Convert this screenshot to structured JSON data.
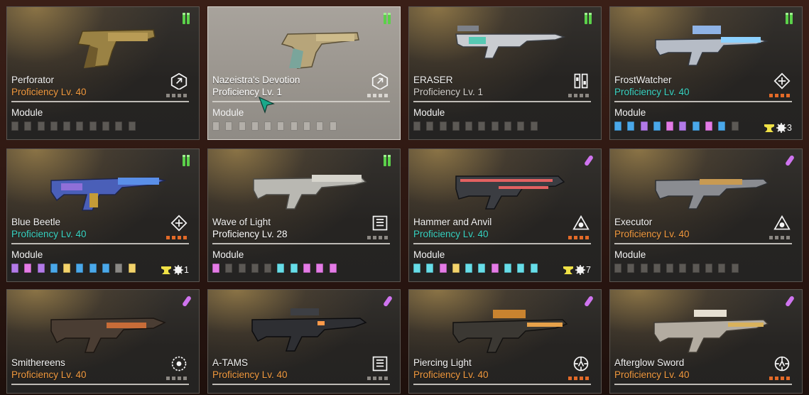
{
  "colors": {
    "orange": "#f29a3f",
    "teal": "#39d4c3",
    "gray": "#d2cfcb",
    "white": "#ffffff",
    "slot_empty": "#5c5955",
    "slot_blue": "#4aa8ea",
    "slot_pink": "#e47be6",
    "slot_purple": "#b27ae8",
    "slot_yellow": "#f3d36b",
    "slot_gray": "#8a8885",
    "slot_cyan": "#67dde8",
    "ammo_green": "#5bd14a",
    "ammo_purple": "#cf74ef"
  },
  "weapons": [
    {
      "name": "Perforator",
      "proficiency": "Proficiency Lv. 40",
      "prof_color": "orange",
      "ammo": "green",
      "ammo_icon": "general-rounds-icon",
      "type_icon": "type-hand-cannon-icon",
      "tier": 0,
      "module_label": "Module",
      "modules": [
        "empty",
        "empty",
        "empty",
        "empty",
        "empty",
        "empty",
        "empty",
        "empty",
        "empty",
        "empty"
      ],
      "capacity": null,
      "gun": "gold-revolver",
      "selected": false
    },
    {
      "name": "Nazeistra's Devotion",
      "proficiency": "Proficiency Lv. 1",
      "prof_color": "white",
      "ammo": "green",
      "ammo_icon": "general-rounds-icon",
      "type_icon": "type-hand-cannon-icon",
      "tier": 0,
      "module_label": "Module",
      "modules": [
        "empty",
        "empty",
        "empty",
        "empty",
        "empty",
        "empty",
        "empty",
        "empty",
        "empty",
        "empty"
      ],
      "capacity": null,
      "gun": "ornate-revolver",
      "selected": true
    },
    {
      "name": "ERASER",
      "proficiency": "Proficiency Lv. 1",
      "prof_color": "gray",
      "ammo": "green",
      "ammo_icon": "general-rounds-icon",
      "type_icon": "type-tactical-rifle-icon",
      "tier": 0,
      "module_label": "Module",
      "modules": [
        "empty",
        "empty",
        "empty",
        "empty",
        "empty",
        "empty",
        "empty",
        "empty",
        "empty",
        "empty"
      ],
      "capacity": null,
      "gun": "white-rifle",
      "selected": false
    },
    {
      "name": "FrostWatcher",
      "proficiency": "Proficiency Lv. 40",
      "prof_color": "teal",
      "ammo": "green",
      "ammo_icon": "general-rounds-icon",
      "type_icon": "type-assault-rifle-icon",
      "tier": 5,
      "module_label": "Module",
      "modules": [
        "blue",
        "blue",
        "purple",
        "blue",
        "pink",
        "purple",
        "blue",
        "pink",
        "blue",
        "empty"
      ],
      "capacity": "3",
      "gun": "frost-rifle",
      "selected": false
    },
    {
      "name": "Blue Beetle",
      "proficiency": "Proficiency Lv. 40",
      "prof_color": "teal",
      "ammo": "green",
      "ammo_icon": "general-rounds-icon",
      "type_icon": "type-assault-rifle-icon",
      "tier": 5,
      "module_label": "Module",
      "modules": [
        "purple",
        "pink",
        "purple",
        "blue",
        "yellow",
        "blue",
        "blue",
        "blue",
        "gray",
        "yellow"
      ],
      "capacity": "1",
      "gun": "beetle-rifle",
      "selected": false
    },
    {
      "name": "Wave of Light",
      "proficiency": "Proficiency Lv. 28",
      "prof_color": "white",
      "ammo": "green",
      "ammo_icon": "general-rounds-icon",
      "type_icon": "type-machine-gun-icon",
      "tier": 0,
      "module_label": "Module",
      "modules": [
        "pink",
        "empty",
        "empty",
        "empty",
        "empty",
        "cyan",
        "cyan",
        "pink",
        "pink",
        "pink"
      ],
      "capacity": null,
      "gun": "light-rifle",
      "selected": false
    },
    {
      "name": "Hammer and Anvil",
      "proficiency": "Proficiency Lv. 40",
      "prof_color": "teal",
      "ammo": "purple",
      "ammo_icon": "impact-rounds-icon",
      "type_icon": "type-shotgun-icon",
      "tier": 5,
      "module_label": "Module",
      "modules": [
        "cyan",
        "cyan",
        "pink",
        "yellow",
        "cyan",
        "cyan",
        "pink",
        "cyan",
        "cyan",
        "cyan"
      ],
      "capacity": "7",
      "gun": "hammer-shotgun",
      "selected": false
    },
    {
      "name": "Executor",
      "proficiency": "Proficiency Lv. 40",
      "prof_color": "orange",
      "ammo": "purple",
      "ammo_icon": "impact-rounds-icon",
      "type_icon": "type-shotgun-icon",
      "tier": 0,
      "module_label": "Module",
      "modules": [
        "empty",
        "empty",
        "empty",
        "empty",
        "empty",
        "empty",
        "empty",
        "empty",
        "empty",
        "empty"
      ],
      "capacity": null,
      "gun": "executor-shotgun",
      "selected": false
    },
    {
      "name": "Smithereens",
      "proficiency": "Proficiency Lv. 40",
      "prof_color": "orange",
      "ammo": "purple",
      "ammo_icon": "impact-rounds-icon",
      "type_icon": "type-launcher-icon",
      "tier": 0,
      "module_label": null,
      "modules": [],
      "capacity": null,
      "gun": "smithereens-launcher",
      "selected": false
    },
    {
      "name": "A-TAMS",
      "proficiency": "Proficiency Lv. 40",
      "prof_color": "orange",
      "ammo": "purple",
      "ammo_icon": "impact-rounds-icon",
      "type_icon": "type-machine-gun-icon",
      "tier": 0,
      "module_label": null,
      "modules": [],
      "capacity": null,
      "gun": "atams-rifle",
      "selected": false
    },
    {
      "name": "Piercing Light",
      "proficiency": "Proficiency Lv. 40",
      "prof_color": "orange",
      "ammo": "purple",
      "ammo_icon": "impact-rounds-icon",
      "type_icon": "type-sniper-icon",
      "tier": 5,
      "module_label": null,
      "modules": [],
      "capacity": null,
      "gun": "piercing-sniper",
      "selected": false
    },
    {
      "name": "Afterglow Sword",
      "proficiency": "Proficiency Lv. 40",
      "prof_color": "orange",
      "ammo": "purple",
      "ammo_icon": "impact-rounds-icon",
      "type_icon": "type-sniper-icon",
      "tier": 5,
      "module_label": null,
      "modules": [],
      "capacity": null,
      "gun": "afterglow-sniper",
      "selected": false
    }
  ]
}
